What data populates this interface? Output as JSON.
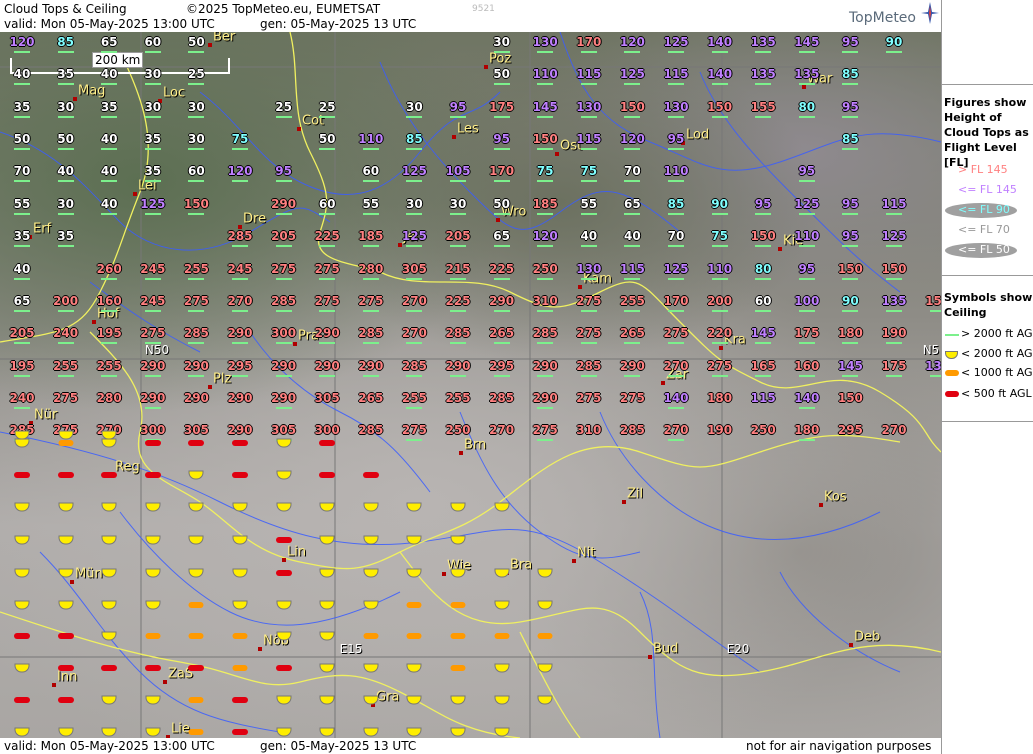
{
  "header": {
    "title": "Cloud Tops & Ceiling",
    "copyright": "©2025 TopMeteo.eu, EUMETSAT",
    "code": "9521",
    "valid": "valid:  Mon  05-May-2025  13:00 UTC",
    "gen": "gen: 05-May-2025 13 UTC",
    "logo": "TopMeteo"
  },
  "footer": {
    "valid": "valid:  Mon  05-May-2025  13:00 UTC",
    "gen": "gen: 05-May-2025 13 UTC",
    "note": "not for air navigation purposes"
  },
  "scale": "200 km",
  "gridlines": {
    "n50": "N50",
    "n5": "N5",
    "e15": "E15",
    "e20": "E20"
  },
  "legend": {
    "figures_title": "Figures show Height of Cloud Tops as Flight Level  [FL]",
    "figure_items": [
      {
        "label": "> FL 145",
        "color": "#ff8080"
      },
      {
        "label": "<= FL 145",
        "color": "#c080ff"
      },
      {
        "label": "<= FL 90",
        "color": "#80ffff"
      },
      {
        "label": "<= FL 70",
        "color": "#ffffff"
      },
      {
        "label": "<= FL 50",
        "color": "#ffffff"
      }
    ],
    "symbols_title": "Symbols show Ceiling",
    "symbol_items": [
      {
        "label": "> 2000 ft AGL",
        "symbol": "green-line"
      },
      {
        "label": "< 2000 ft AGL",
        "symbol": "yellow-cup"
      },
      {
        "label": "< 1000 ft AGL",
        "symbol": "orange-bar"
      },
      {
        "label": "< 500 ft AGL",
        "symbol": "red-bar"
      }
    ]
  },
  "colors": {
    "high": "#ff8080",
    "mid": "#c080ff",
    "low90": "#80ffff",
    "low": "#ffffff",
    "green": "#7cf08c",
    "yellow": "#ffee00",
    "orange": "#ff9a00",
    "red": "#e00010"
  },
  "cities": [
    "Ber",
    "Poz",
    "War",
    "Mag",
    "Loc",
    "Cot",
    "Les",
    "Lod",
    "Ost",
    "Lei",
    "Wro",
    "Dre",
    "Jel",
    "Kie",
    "Erf",
    "Kam",
    "Hof",
    "Pra",
    "Kra",
    "Plz",
    "Zar",
    "Nür",
    "Brn",
    "Reg",
    "Zil",
    "Kos",
    "Lin",
    "Nit",
    "Mün",
    "Wie",
    "Bra",
    "Nöb",
    "Bud",
    "Deb",
    "Inn",
    "ZaS",
    "Gra",
    "Lie"
  ],
  "rows": [
    [
      "120",
      "85",
      "65",
      "60",
      "50",
      "",
      "",
      "",
      "",
      "",
      "",
      "30",
      "130",
      "170",
      "120",
      "125",
      "140",
      "135",
      "145",
      "95",
      "90"
    ],
    [
      "40",
      "35",
      "40",
      "30",
      "25",
      "",
      "",
      "",
      "",
      "",
      "",
      "50",
      "110",
      "115",
      "125",
      "115",
      "140",
      "135",
      "135",
      "85"
    ],
    [
      "35",
      "30",
      "35",
      "30",
      "30",
      "",
      "25",
      "25",
      "",
      "30",
      "95",
      "175",
      "145",
      "130",
      "150",
      "130",
      "150",
      "155",
      "80",
      "95"
    ],
    [
      "50",
      "50",
      "40",
      "35",
      "30",
      "75",
      "",
      "50",
      "110",
      "85",
      "",
      "95",
      "150",
      "115",
      "120",
      "95",
      "",
      "",
      "",
      "85"
    ],
    [
      "70",
      "40",
      "40",
      "35",
      "60",
      "120",
      "95",
      "",
      "60",
      "125",
      "105",
      "170",
      "75",
      "75",
      "70",
      "110",
      "",
      "",
      "95",
      ""
    ],
    [
      "55",
      "30",
      "40",
      "125",
      "150",
      "",
      "290",
      "60",
      "55",
      "30",
      "30",
      "50",
      "185",
      "55",
      "65",
      "85",
      "90",
      "95",
      "125",
      "95",
      "115"
    ],
    [
      "35",
      "35",
      "",
      "",
      "",
      "285",
      "205",
      "225",
      "185",
      "125",
      "205",
      "65",
      "120",
      "40",
      "40",
      "70",
      "75",
      "150",
      "110",
      "95",
      "125"
    ],
    [
      "40",
      "",
      "260",
      "245",
      "255",
      "245",
      "275",
      "275",
      "280",
      "305",
      "215",
      "225",
      "250",
      "130",
      "115",
      "125",
      "110",
      "80",
      "95",
      "150",
      "150"
    ],
    [
      "65",
      "200",
      "160",
      "245",
      "275",
      "270",
      "285",
      "275",
      "275",
      "270",
      "225",
      "290",
      "310",
      "275",
      "255",
      "170",
      "200",
      "60",
      "100",
      "90",
      "135",
      "150"
    ],
    [
      "205",
      "240",
      "195",
      "275",
      "285",
      "290",
      "300",
      "290",
      "285",
      "270",
      "285",
      "265",
      "285",
      "275",
      "265",
      "275",
      "220",
      "145",
      "175",
      "180",
      "190"
    ],
    [
      "195",
      "255",
      "255",
      "290",
      "290",
      "295",
      "290",
      "290",
      "290",
      "285",
      "290",
      "295",
      "290",
      "285",
      "290",
      "270",
      "275",
      "165",
      "160",
      "145",
      "175",
      "135"
    ],
    [
      "240",
      "275",
      "280",
      "290",
      "290",
      "290",
      "290",
      "305",
      "265",
      "255",
      "255",
      "285",
      "290",
      "275",
      "275",
      "140",
      "180",
      "115",
      "140",
      "150"
    ],
    [
      "285",
      "275",
      "270",
      "300",
      "305",
      "290",
      "305",
      "300",
      "285",
      "275",
      "250",
      "270",
      "275",
      "310",
      "285",
      "270",
      "190",
      "250",
      "180",
      "295",
      "270"
    ]
  ]
}
